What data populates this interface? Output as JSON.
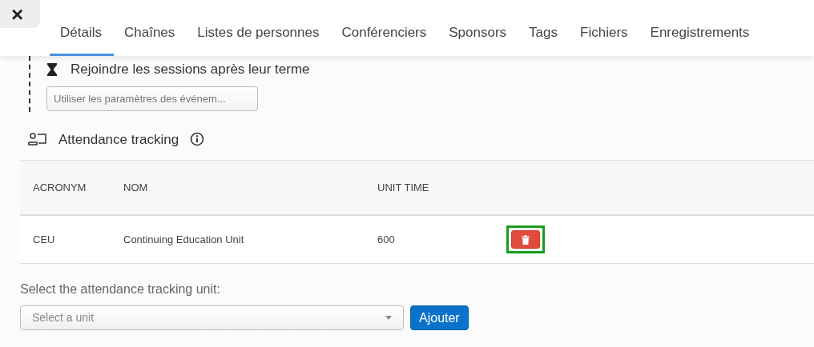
{
  "close_button": {
    "label": "×"
  },
  "tabs": [
    {
      "label": "Détails",
      "selected": true
    },
    {
      "label": "Chaînes",
      "selected": false
    },
    {
      "label": "Listes de personnes",
      "selected": false
    },
    {
      "label": "Conférenciers",
      "selected": false
    },
    {
      "label": "Sponsors",
      "selected": false
    },
    {
      "label": "Tags",
      "selected": false
    },
    {
      "label": "Fichiers",
      "selected": false
    },
    {
      "label": "Enregistrements",
      "selected": false
    }
  ],
  "join_setting": {
    "title": "Rejoindre les sessions après leur terme",
    "select_value": "Utiliser les paramètres des événem..."
  },
  "attendance": {
    "title": "Attendance tracking",
    "table": {
      "columns": [
        "ACRONYM",
        "NOM",
        "UNIT TIME"
      ],
      "rows": [
        {
          "cells": [
            "CEU",
            "Continuing Education Unit",
            "600"
          ],
          "delete_highlighted": true
        }
      ]
    },
    "unit_label": "Select the attendance tracking unit:",
    "unit_placeholder": "Select a unit",
    "add_button": "Ajouter"
  }
}
